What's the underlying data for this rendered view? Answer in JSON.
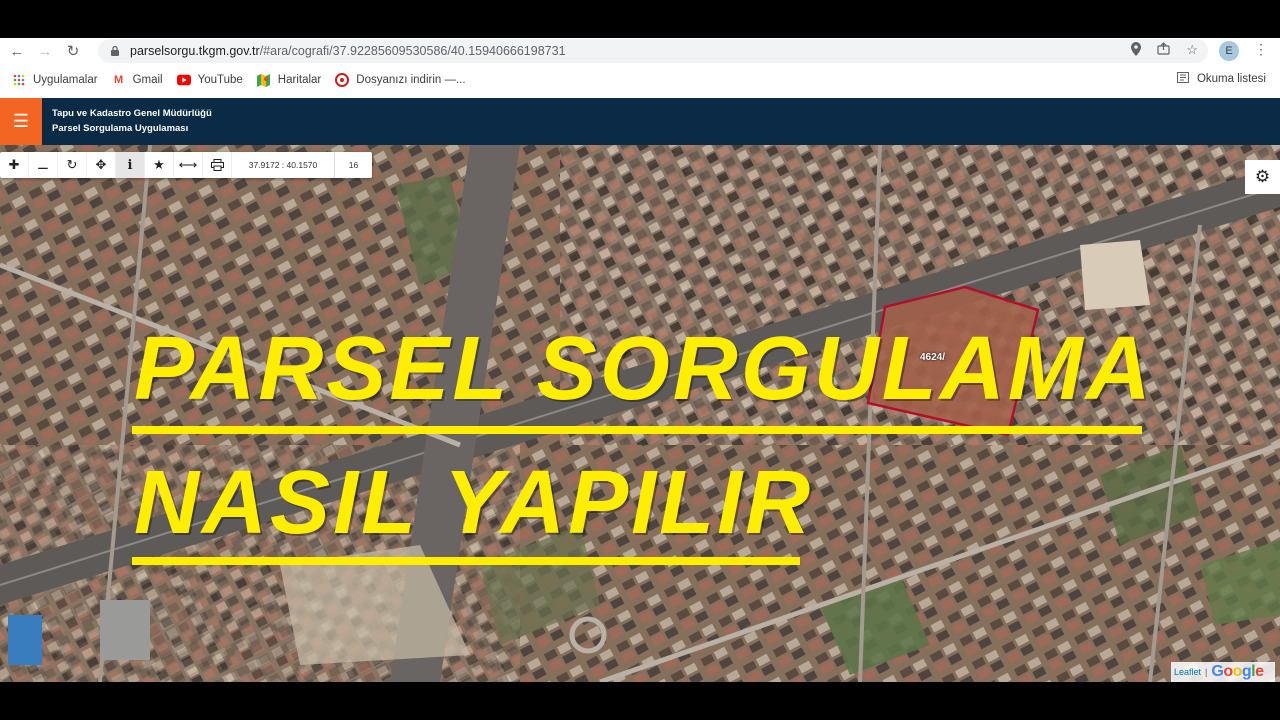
{
  "browser": {
    "url_host": "parselsorgu.tkgm.gov.tr",
    "url_path": "/#ara/cografi/37.92285609530586/40.15940666198731",
    "avatar_letter": "E",
    "bookmarks": [
      {
        "label": "Uygulamalar",
        "icon": "apps-grid-icon"
      },
      {
        "label": "Gmail",
        "icon": "gmail-icon"
      },
      {
        "label": "YouTube",
        "icon": "youtube-icon"
      },
      {
        "label": "Haritalar",
        "icon": "maps-icon"
      },
      {
        "label": "Dosyanızı indirin —...",
        "icon": "download-site-icon"
      }
    ],
    "reading_list": "Okuma listesi"
  },
  "app": {
    "org_line1": "Tapu ve Kadastro Genel Müdürlüğü",
    "org_line2": "Parsel Sorgulama Uygulaması",
    "accent": "#f26522",
    "header_bg": "#0a2a45"
  },
  "map": {
    "coordinates": "37.9172 : 40.1570",
    "zoom_level": "16",
    "parcel_label": "4624/",
    "attribution_leaflet": "Leaflet",
    "attribution_google": "Google"
  },
  "overlay": {
    "line1": "PARSEL SORGULAMA",
    "line2": "NASIL YAPILIR",
    "color": "#ffee00"
  }
}
